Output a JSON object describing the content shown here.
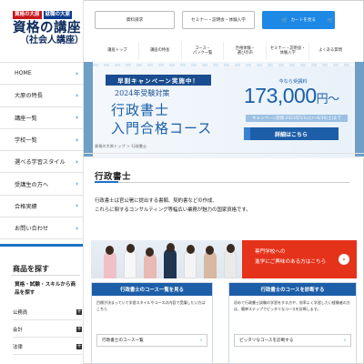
{
  "logo": {
    "tag1": "資格の大原",
    "tag2": "就職の大原",
    "main": "資格の講座",
    "sub": "（社会人講座）"
  },
  "sidebar_nav": [
    {
      "label": "HOME"
    },
    {
      "label": "大原の特長"
    },
    {
      "label": "講座一覧"
    },
    {
      "label": "学校一覧"
    },
    {
      "label": "選べる学習スタイル"
    },
    {
      "label": "受講生の方へ"
    },
    {
      "label": "合格実績"
    },
    {
      "label": "お問い合わせ"
    }
  ],
  "find": {
    "title": "商品を探す",
    "desc": "資格・試験・スキルから商品を探す"
  },
  "categories": [
    {
      "label": "公務員"
    },
    {
      "label": "会計"
    },
    {
      "label": "法律"
    }
  ],
  "header": {
    "btn1": "資料請求",
    "btn2": "セミナー・説明会・体験入学",
    "cart": "カートを見る",
    "cart_icon": "cart-icon"
  },
  "subnav": [
    {
      "l1": "講座トップ",
      "l2": ""
    },
    {
      "l1": "講座の特長",
      "l2": ""
    },
    {
      "l1": "コース・",
      "l2": "パック一覧"
    },
    {
      "l1": "合格体験・",
      "l2": "選びの声"
    },
    {
      "l1": "セミナー・説明会・",
      "l2": "体験入学"
    },
    {
      "l1": "よくある質問",
      "l2": ""
    }
  ],
  "banner": {
    "tag": "早割キャンペーン実施中！",
    "year": "2024年受験対策",
    "title1": "行政書士",
    "title2": "入門合格コース",
    "now": "今なら受講料",
    "price": "173,000",
    "price_unit": "円〜",
    "period": "キャンペーン期間:2023年5/1(火)〜6/30(土)まで",
    "detail": "詳細はこちら"
  },
  "breadcrumb": "資格の大原トップ  ＞  行政書士",
  "page_title": "行政書士",
  "intro": [
    "行政書士は官公署に提出する書類、契約書などの作成、",
    "これらに関するコンサルティング等幅広い業務が魅力の国家資格です。"
  ],
  "promo": {
    "line1": "専門学校への",
    "line2": "進学にご興味のある方はこちら"
  },
  "cards": [
    {
      "head": "行政書士のコース一覧を見る",
      "desc": "目標が決まっていて学習スタイルやコースの内容で受講したい方はこちら",
      "link": "行政書士のコース一覧"
    },
    {
      "head": "行政書士のコースを診断する",
      "desc": "初めて行政書士試験の学習をする方や、効率よく学習したい経験者の方は、簡単ステップでピッタリなコースを診断します。",
      "link": "ピッタリなコースを診断する"
    }
  ],
  "colors": {
    "brand_blue": "#1c5ea8",
    "accent_red": "#e5321b",
    "cart_blue": "#1e88e5"
  }
}
